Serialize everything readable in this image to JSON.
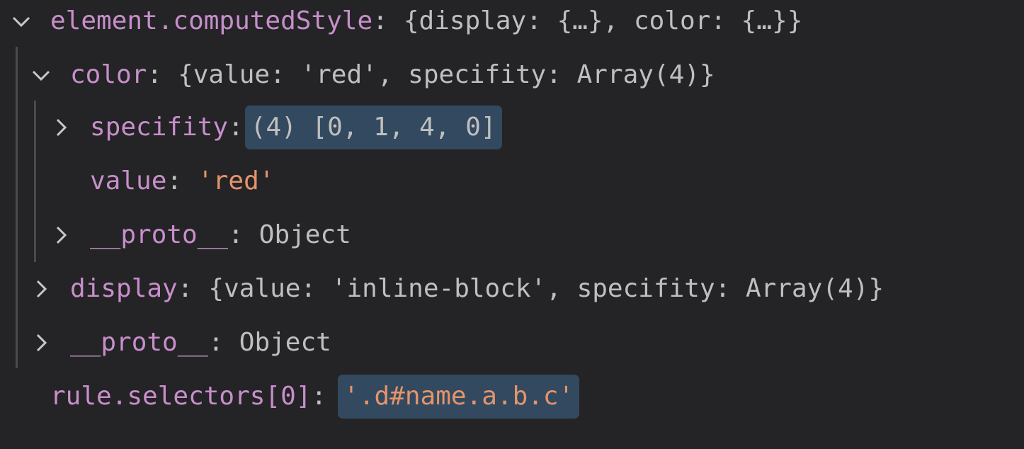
{
  "rows": {
    "computed_style": {
      "key": "element.computedStyle",
      "colon": ":",
      "preview": "{display: {…}, color: {…}}"
    },
    "color": {
      "key": "color",
      "colon": ":",
      "preview": "{value: 'red', specifity: Array(4)}"
    },
    "specifity": {
      "key": "specifity",
      "colon": ":",
      "preview": "(4) [0, 1, 4, 0]"
    },
    "value": {
      "key": "value",
      "colon": ":",
      "preview": "'red'"
    },
    "color_proto": {
      "key": "__proto__",
      "colon": ":",
      "preview": "Object"
    },
    "display": {
      "key": "display",
      "colon": ":",
      "preview": "{value: 'inline-block', specifity: Array(4)}"
    },
    "style_proto": {
      "key": "__proto__",
      "colon": ":",
      "preview": "Object"
    },
    "selectors": {
      "key": "rule.selectors[0]",
      "colon": ":",
      "preview": "'.d#name.a.b.c'"
    }
  },
  "icons": {
    "expanded": "chevron-down-icon",
    "collapsed": "chevron-right-icon"
  },
  "colors": {
    "background": "#242426",
    "key": "#c88ecb",
    "string": "#e3946c",
    "text": "#bfbfbf",
    "highlight": "#33495f",
    "guide": "#4a4a4c"
  }
}
